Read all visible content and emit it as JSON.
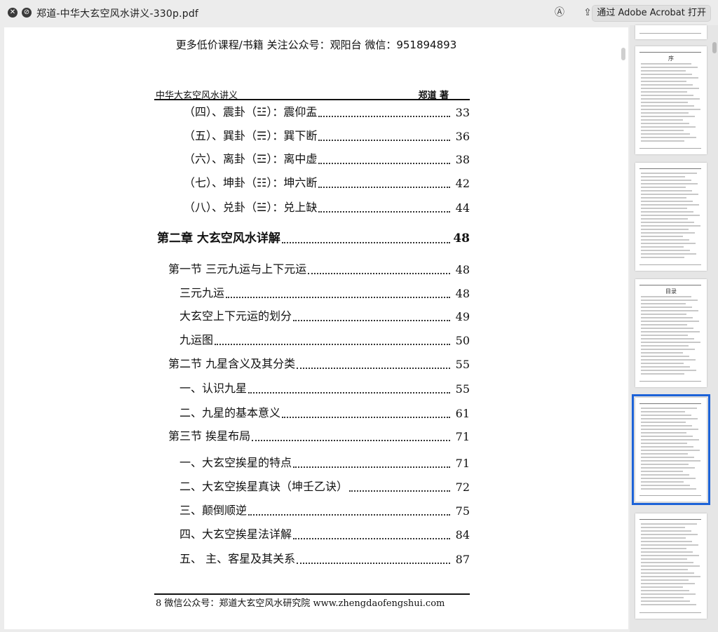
{
  "window": {
    "title": "郑道-中华大玄空风水讲义-330p.pdf",
    "open_button": "通过 Adobe Acrobat 打开"
  },
  "icons": {
    "close": "close-icon",
    "stop": "stop-icon",
    "markup": "markup-icon",
    "share": "share-icon"
  },
  "page": {
    "promo": "更多低价课程/书籍  关注公众号：观阳台   微信：951894893",
    "book_title": "中华大玄空风水讲义",
    "author": "郑道  著",
    "footer": "8    微信公众号：郑道大玄空风水研究院     www.zhengdaofengshui.com"
  },
  "toc": [
    {
      "text": "（四）、震卦（☳）：震仰盂",
      "page": "33",
      "level": 3
    },
    {
      "text": "（五）、巽卦（☴）：巽下断",
      "page": "36",
      "level": 3
    },
    {
      "text": "（六）、离卦（☲）：离中虚",
      "page": "38",
      "level": 3
    },
    {
      "text": "（七）、坤卦（☷）：坤六断",
      "page": "42",
      "level": 3
    },
    {
      "text": "（八）、兑卦（☱）：兑上缺",
      "page": "44",
      "level": 3
    },
    {
      "text": "第二章  大玄空风水详解",
      "page": "48",
      "level": 0
    },
    {
      "text": "第一节  三元九运与上下元运",
      "page": "48",
      "level": 1
    },
    {
      "text": "三元九运",
      "page": "48",
      "level": 2
    },
    {
      "text": "大玄空上下元运的划分",
      "page": "49",
      "level": 2
    },
    {
      "text": "九运图",
      "page": "50",
      "level": 2
    },
    {
      "text": "第二节   九星含义及其分类",
      "page": "55",
      "level": 1
    },
    {
      "text": "一、认识九星",
      "page": "55",
      "level": 2
    },
    {
      "text": "二、九星的基本意义",
      "page": "61",
      "level": 2
    },
    {
      "text": "第三节   挨星布局",
      "page": "71",
      "level": 1
    },
    {
      "text": "一、大玄空挨星的特点",
      "page": "71",
      "level": 2
    },
    {
      "text": "二、大玄空挨星真诀（坤壬乙诀）",
      "page": "72",
      "level": 2
    },
    {
      "text": "三、颠倒顺逆",
      "page": "75",
      "level": 2
    },
    {
      "text": "四、大玄空挨星法详解",
      "page": "84",
      "level": 2
    },
    {
      "text": "五、  主、客星及其关系",
      "page": "87",
      "level": 2
    }
  ],
  "thumbnails": {
    "preface_title": "序",
    "toc_title": "目录"
  }
}
